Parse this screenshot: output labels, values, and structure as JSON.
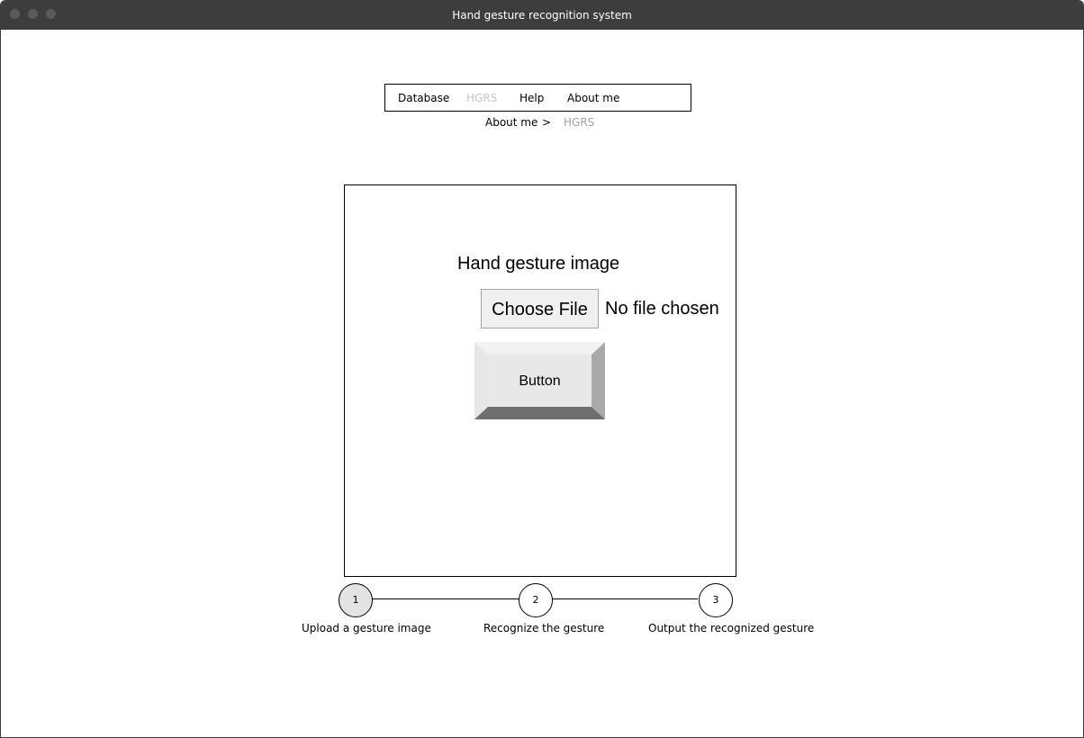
{
  "window": {
    "title": "Hand gesture recognition system"
  },
  "menu": {
    "items": [
      {
        "label": "Database"
      },
      {
        "label": "HGRS",
        "disabled": true
      },
      {
        "label": "Help"
      },
      {
        "label": "About me"
      }
    ]
  },
  "breadcrumb": {
    "parent": "About me",
    "separator": ">",
    "current": "HGRS"
  },
  "panel": {
    "title": "Hand gesture image",
    "file_input": {
      "button_label": "Choose File",
      "status": "No file chosen"
    },
    "submit_label": "Button"
  },
  "stepper": {
    "active_step": 1,
    "steps": [
      {
        "number": "1",
        "label": "Upload a gesture image"
      },
      {
        "number": "2",
        "label": "Recognize the gesture"
      },
      {
        "number": "3",
        "label": "Output the recognized gesture"
      }
    ]
  },
  "colors": {
    "titlebar": "#3d3d3d",
    "disabled_text": "#c4c4c4",
    "breadcrumb_current": "#a0a0a0",
    "active_step_fill": "#e3e3e3"
  }
}
